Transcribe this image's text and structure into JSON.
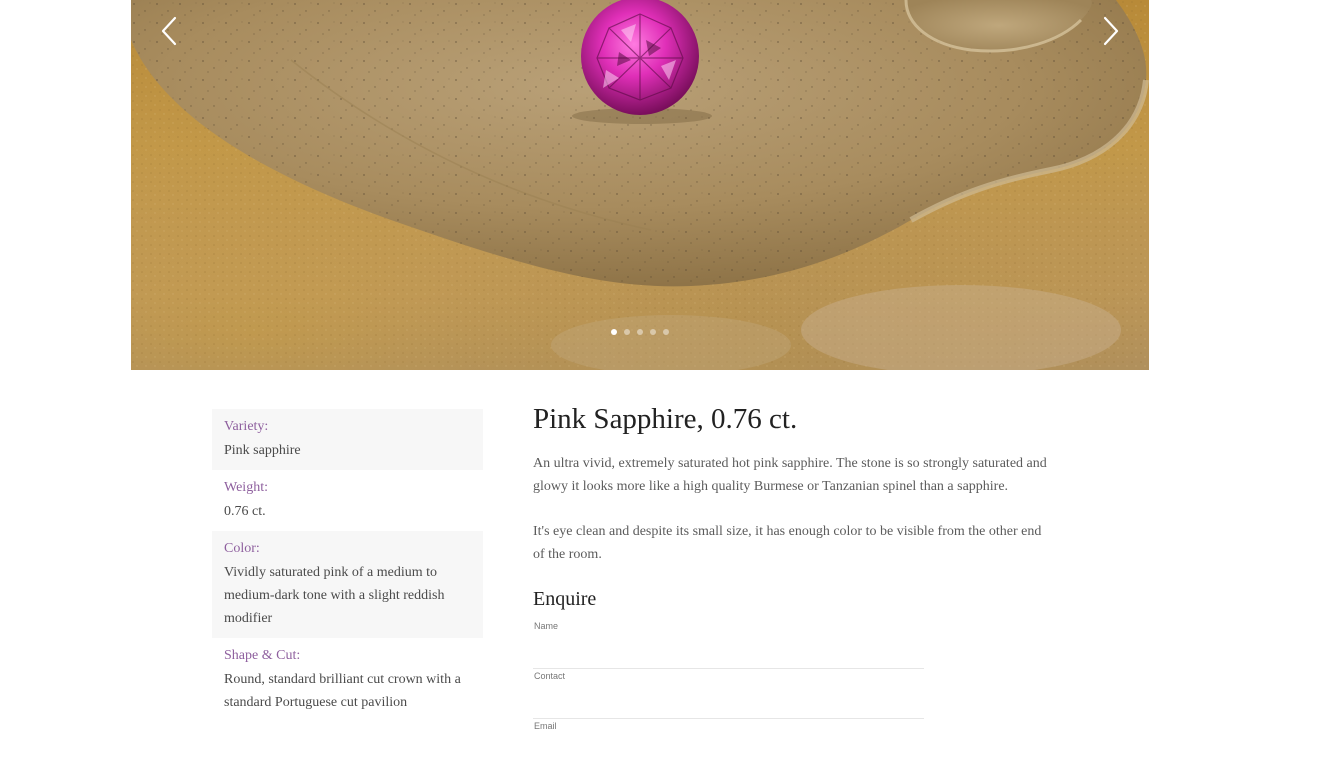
{
  "gallery": {
    "prev_icon": "chevron-left-icon",
    "next_icon": "chevron-right-icon",
    "slide_count": 5,
    "active_slide": 1,
    "colors": {
      "gem": "#e02fb8",
      "leaf": "#b09464",
      "stone": "#b88a38"
    }
  },
  "specs": [
    {
      "label": "Variety:",
      "value": "Pink sapphire"
    },
    {
      "label": "Weight:",
      "value": "0.76 ct."
    },
    {
      "label": "Color:",
      "value": "Vividly saturated pink of a medium to medium-dark tone with a slight reddish modifier"
    },
    {
      "label": "Shape & Cut:",
      "value": "Round, standard brilliant cut crown with a standard Portuguese cut pavilion"
    }
  ],
  "product": {
    "title": "Pink Sapphire, 0.76 ct.",
    "paragraphs": [
      "An ultra vivid, extremely saturated hot pink sapphire. The stone is so  strongly saturated and glowy it looks more like a high quality Burmese or Tanzanian spinel than a sapphire.",
      "It's eye clean and despite its small size, it has enough color to be visible from the other end of the room."
    ]
  },
  "enquire": {
    "title": "Enquire",
    "fields": [
      {
        "label": "Name"
      },
      {
        "label": "Contact"
      },
      {
        "label": "Email"
      }
    ]
  },
  "colors": {
    "accent": "#8e5f9e",
    "spec_bg": "#f7f7f7",
    "text": "#4a4a4a"
  }
}
